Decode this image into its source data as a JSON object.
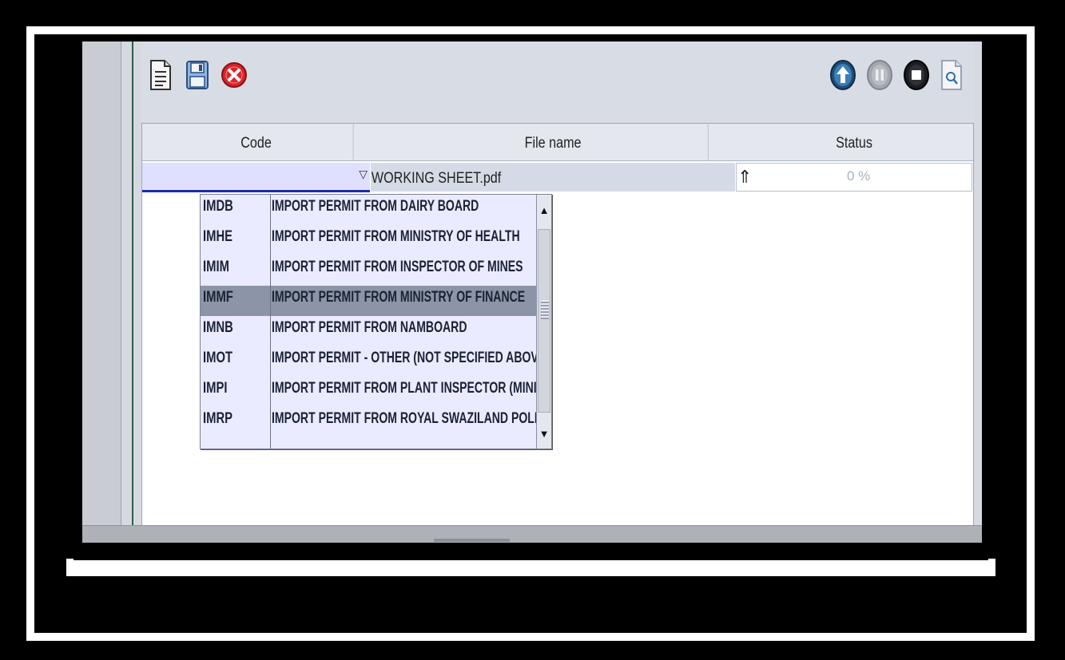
{
  "toolbar": {
    "left_buttons": [
      "new-document-icon",
      "save-icon",
      "delete-icon"
    ],
    "right_buttons": [
      "upload-icon",
      "pause-icon",
      "stop-icon",
      "preview-icon"
    ]
  },
  "table": {
    "columns": [
      "Code",
      "File name",
      "Status"
    ],
    "row": {
      "code": "",
      "dropdown_arrow": "▽",
      "file_name": "WORKING SHEET.pdf",
      "status_icon": "⇑",
      "progress": "0 %"
    }
  },
  "dropdown": {
    "selected_index": 3,
    "items": [
      {
        "code": "IMDB",
        "description": "IMPORT PERMIT FROM DAIRY BOARD"
      },
      {
        "code": "IMHE",
        "description": "IMPORT PERMIT FROM MINISTRY OF HEALTH"
      },
      {
        "code": "IMIM",
        "description": "IMPORT PERMIT FROM  INSPECTOR OF MINES"
      },
      {
        "code": "IMMF",
        "description": "IMPORT PERMIT FROM MINISTRY OF FINANCE"
      },
      {
        "code": "IMNB",
        "description": "IMPORT PERMIT FROM NAMBOARD"
      },
      {
        "code": "IMOT",
        "description": "IMPORT PERMIT - OTHER (NOT SPECIFIED ABOVE)"
      },
      {
        "code": "IMPI",
        "description": "IMPORT PERMIT FROM PLANT INSPECTOR (MINIST"
      },
      {
        "code": "IMRP",
        "description": "IMPORT PERMIT FROM ROYAL SWAZILAND POLICE"
      }
    ],
    "scroll_up": "▲",
    "scroll_down": "▼"
  }
}
